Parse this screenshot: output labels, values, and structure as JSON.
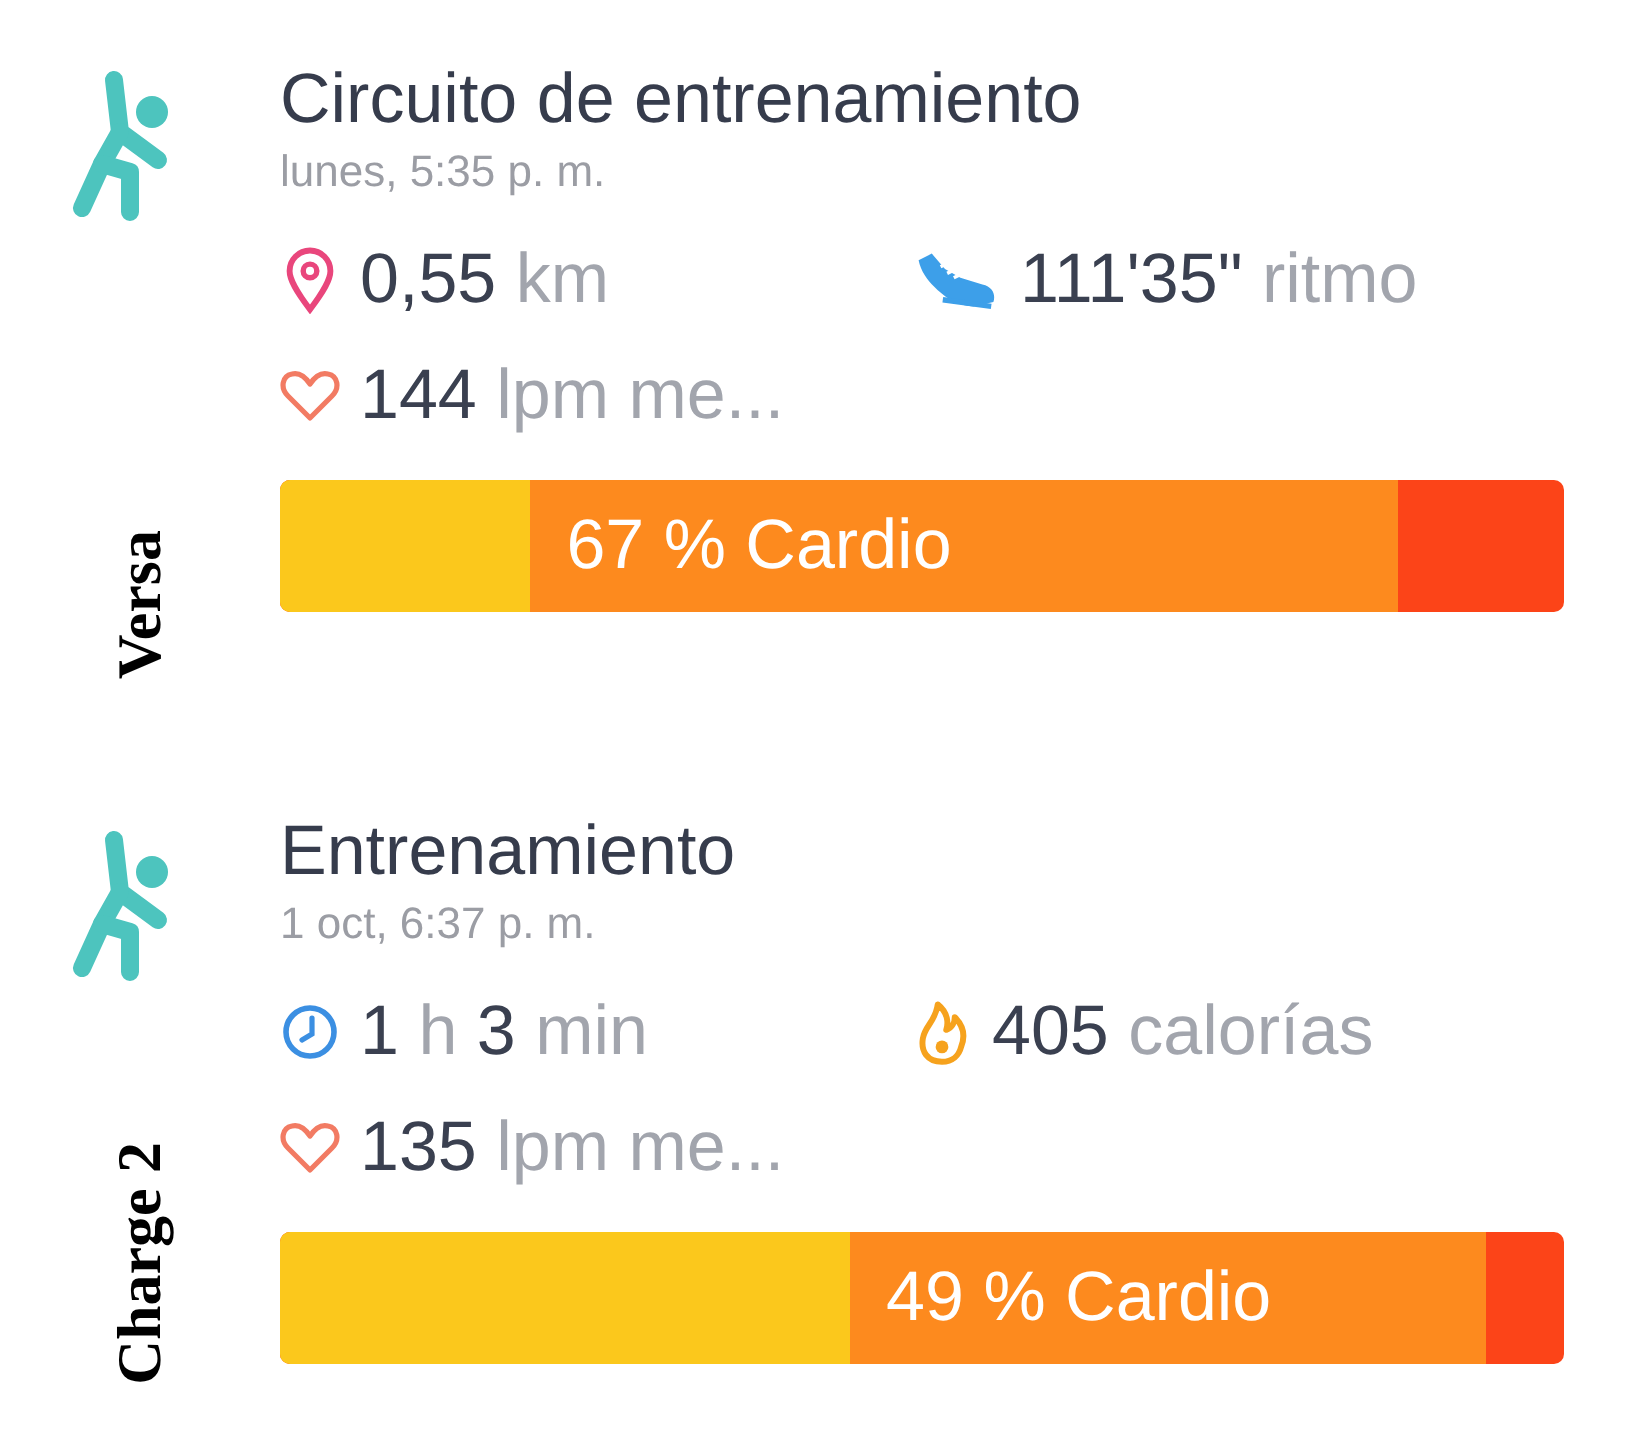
{
  "activities": [
    {
      "title": "Circuito de entrenamiento",
      "time": "lunes, 5:35 p. m.",
      "device": "Versa",
      "stats": [
        {
          "kind": "distance",
          "parts": [
            {
              "text": "0,55",
              "kind": "value"
            },
            {
              "text": "km",
              "kind": "unit"
            }
          ]
        },
        {
          "kind": "pace",
          "parts": [
            {
              "text": "111'35\"",
              "kind": "value"
            },
            {
              "text": "ritmo",
              "kind": "unit"
            }
          ]
        },
        {
          "kind": "heart",
          "parts": [
            {
              "text": "144",
              "kind": "value"
            },
            {
              "text": "lpm me...",
              "kind": "unit"
            }
          ]
        }
      ],
      "zone_bar": {
        "label": "67 % Cardio",
        "fills": [
          {
            "kind": "up_to_cardio",
            "level": 0.87
          },
          {
            "kind": "fat_burn",
            "level": 0.195
          }
        ]
      }
    },
    {
      "title": "Entrenamiento",
      "time": "1 oct, 6:37 p. m.",
      "device": "Charge 2",
      "stats": [
        {
          "kind": "duration",
          "parts": [
            {
              "text": "1",
              "kind": "value"
            },
            {
              "text": "h",
              "kind": "unit"
            },
            {
              "text": "3",
              "kind": "value"
            },
            {
              "text": "min",
              "kind": "unit"
            }
          ]
        },
        {
          "kind": "calories",
          "parts": [
            {
              "text": "405",
              "kind": "value"
            },
            {
              "text": "calorías",
              "kind": "unit"
            }
          ]
        },
        {
          "kind": "heart",
          "parts": [
            {
              "text": "135",
              "kind": "value"
            },
            {
              "text": "lpm me...",
              "kind": "unit"
            }
          ]
        }
      ],
      "zone_bar": {
        "label": "49 % Cardio",
        "fills": [
          {
            "kind": "up_to_cardio",
            "level": 0.94
          },
          {
            "kind": "fat_burn",
            "level": 0.444
          }
        ]
      }
    }
  ]
}
